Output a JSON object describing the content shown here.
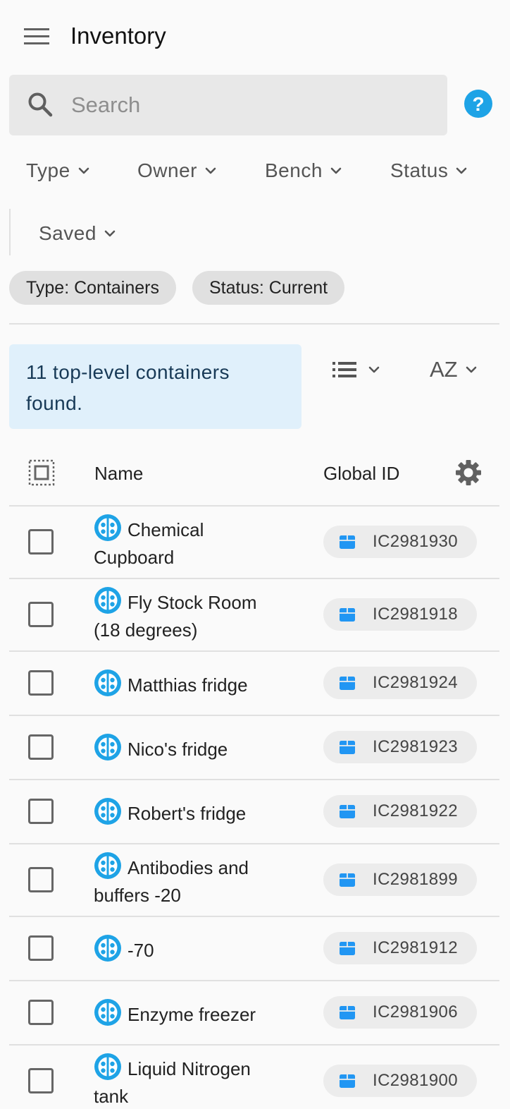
{
  "header": {
    "title": "Inventory"
  },
  "search": {
    "placeholder": "Search",
    "value": ""
  },
  "filters": [
    {
      "label": "Type"
    },
    {
      "label": "Owner"
    },
    {
      "label": "Bench"
    },
    {
      "label": "Status"
    },
    {
      "label": "Saved"
    }
  ],
  "chips": [
    {
      "label": "Type: Containers"
    },
    {
      "label": "Status: Current"
    }
  ],
  "results": {
    "text": "11 top-level containers found."
  },
  "sort": {
    "label": "AZ"
  },
  "table": {
    "columns": {
      "name": "Name",
      "global_id": "Global ID"
    },
    "rows": [
      {
        "name": "Chemical Cupboard",
        "global_id": "IC2981930"
      },
      {
        "name": "Fly Stock Room (18 degrees)",
        "global_id": "IC2981918"
      },
      {
        "name": "Matthias fridge",
        "global_id": "IC2981924"
      },
      {
        "name": "Nico's fridge",
        "global_id": "IC2981923"
      },
      {
        "name": "Robert's fridge",
        "global_id": "IC2981922"
      },
      {
        "name": "Antibodies and buffers -20",
        "global_id": "IC2981899"
      },
      {
        "name": "-70",
        "global_id": "IC2981912"
      },
      {
        "name": "Enzyme freezer",
        "global_id": "IC2981906"
      },
      {
        "name": "Liquid Nitrogen tank",
        "global_id": "IC2981900"
      }
    ]
  },
  "colors": {
    "accent": "#1ea3e6",
    "box_icon": "#2196f3",
    "banner_bg": "#e0f0fb",
    "banner_text": "#183a57"
  },
  "icons": {
    "menu": "menu-icon",
    "search": "search-icon",
    "help": "help-icon",
    "chevron": "chevron-down-icon",
    "list_view": "list-view-icon",
    "select_all": "select-all-icon",
    "settings": "gear-icon",
    "container": "container-icon",
    "box": "box-icon"
  }
}
